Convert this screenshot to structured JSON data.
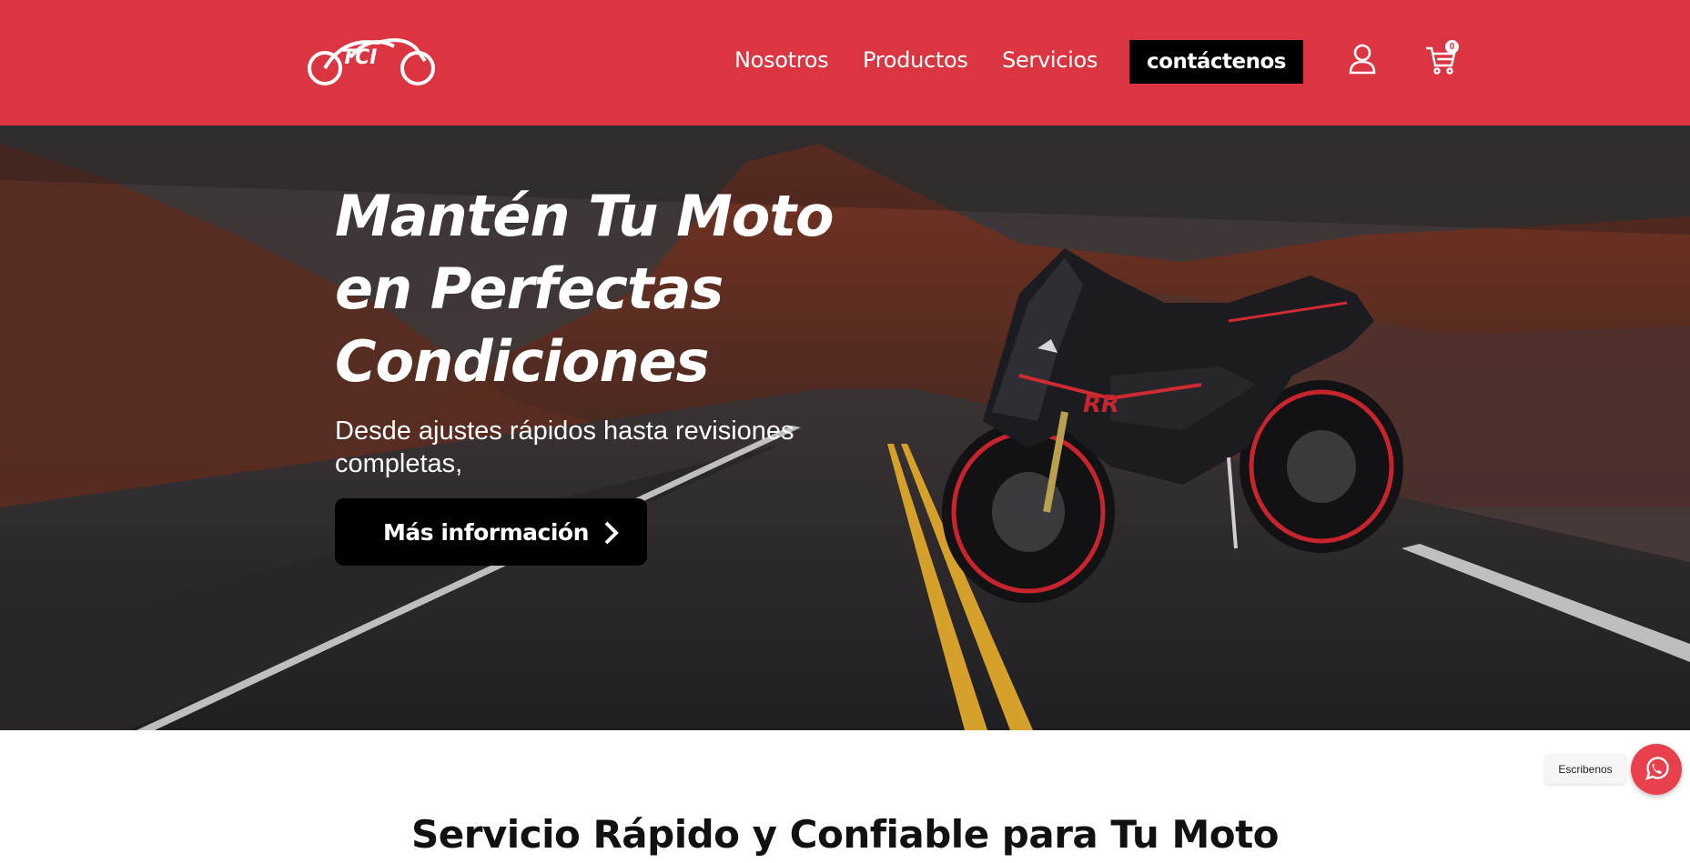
{
  "header": {
    "brand": "TCI",
    "nav": [
      {
        "label": "Nosotros"
      },
      {
        "label": "Productos"
      },
      {
        "label": "Servicios"
      }
    ],
    "cta_label": "contáctenos",
    "cart_count": "0",
    "colors": {
      "header_bg": "#db3541",
      "cta_bg": "#000000"
    }
  },
  "hero": {
    "title_line1": "Mantén Tu Moto",
    "title_line2": "en Perfectas",
    "title_line3": "Condiciones",
    "subtitle": "Desde ajustes rápidos hasta revisiones completas,",
    "button_label": "Más información"
  },
  "section": {
    "title": "Servicio Rápido y Confiable para Tu Moto"
  },
  "whatsapp": {
    "label": "Escribenos",
    "color": "#e8404c"
  }
}
